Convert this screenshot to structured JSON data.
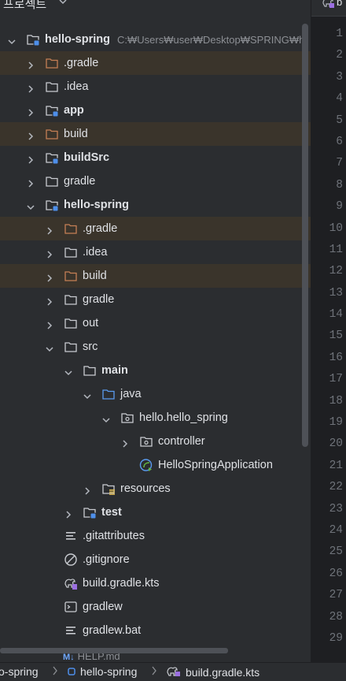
{
  "panel": {
    "title": "프로젝트"
  },
  "tree": {
    "root_label": "hello-spring",
    "root_path": "C:₩Users₩user₩Desktop₩SPRING₩h",
    "items": [
      {
        "label": "hello-spring",
        "depth": 0,
        "arrow": "down",
        "icon": "module-folder",
        "bold": true,
        "excluded": false
      },
      {
        "label": ".gradle",
        "depth": 1,
        "arrow": "right",
        "icon": "excluded-folder",
        "bold": false,
        "excluded": true
      },
      {
        "label": ".idea",
        "depth": 1,
        "arrow": "right",
        "icon": "folder",
        "bold": false,
        "excluded": false
      },
      {
        "label": "app",
        "depth": 1,
        "arrow": "right",
        "icon": "module-folder",
        "bold": true,
        "excluded": false
      },
      {
        "label": "build",
        "depth": 1,
        "arrow": "right",
        "icon": "excluded-folder",
        "bold": false,
        "excluded": true
      },
      {
        "label": "buildSrc",
        "depth": 1,
        "arrow": "right",
        "icon": "module-folder",
        "bold": true,
        "excluded": false
      },
      {
        "label": "gradle",
        "depth": 1,
        "arrow": "right",
        "icon": "folder",
        "bold": false,
        "excluded": false
      },
      {
        "label": "hello-spring",
        "depth": 1,
        "arrow": "down",
        "icon": "module-folder",
        "bold": true,
        "excluded": false
      },
      {
        "label": ".gradle",
        "depth": 2,
        "arrow": "right",
        "icon": "excluded-folder",
        "bold": false,
        "excluded": true
      },
      {
        "label": ".idea",
        "depth": 2,
        "arrow": "right",
        "icon": "folder",
        "bold": false,
        "excluded": false
      },
      {
        "label": "build",
        "depth": 2,
        "arrow": "right",
        "icon": "excluded-folder",
        "bold": false,
        "excluded": true
      },
      {
        "label": "gradle",
        "depth": 2,
        "arrow": "right",
        "icon": "folder",
        "bold": false,
        "excluded": false
      },
      {
        "label": "out",
        "depth": 2,
        "arrow": "right",
        "icon": "folder",
        "bold": false,
        "excluded": false
      },
      {
        "label": "src",
        "depth": 2,
        "arrow": "down",
        "icon": "folder",
        "bold": false,
        "excluded": false
      },
      {
        "label": "main",
        "depth": 3,
        "arrow": "down",
        "icon": "folder",
        "bold": true,
        "excluded": false
      },
      {
        "label": "java",
        "depth": 4,
        "arrow": "down",
        "icon": "source-folder",
        "bold": false,
        "excluded": false
      },
      {
        "label": "hello.hello_spring",
        "depth": 5,
        "arrow": "down",
        "icon": "package",
        "bold": false,
        "excluded": false
      },
      {
        "label": "controller",
        "depth": 6,
        "arrow": "right",
        "icon": "package",
        "bold": false,
        "excluded": false
      },
      {
        "label": "HelloSpringApplication",
        "depth": 6,
        "arrow": "none",
        "icon": "spring-class",
        "bold": false,
        "excluded": false
      },
      {
        "label": "resources",
        "depth": 4,
        "arrow": "right",
        "icon": "resources-folder",
        "bold": false,
        "excluded": false
      },
      {
        "label": "test",
        "depth": 3,
        "arrow": "right",
        "icon": "module-folder",
        "bold": true,
        "excluded": false
      },
      {
        "label": ".gitattributes",
        "depth": 2,
        "arrow": "none",
        "icon": "text-file",
        "bold": false,
        "excluded": false
      },
      {
        "label": ".gitignore",
        "depth": 2,
        "arrow": "none",
        "icon": "ignore-file",
        "bold": false,
        "excluded": false
      },
      {
        "label": "build.gradle.kts",
        "depth": 2,
        "arrow": "none",
        "icon": "gradle-file",
        "bold": false,
        "excluded": false
      },
      {
        "label": "gradlew",
        "depth": 2,
        "arrow": "none",
        "icon": "terminal-file",
        "bold": false,
        "excluded": false
      },
      {
        "label": "gradlew.bat",
        "depth": 2,
        "arrow": "none",
        "icon": "text-file",
        "bold": false,
        "excluded": false
      }
    ],
    "partial_item": {
      "badge": "M↓",
      "label": "HELP.md"
    }
  },
  "editor": {
    "tab_label": "b",
    "line_numbers": [
      "1",
      "2",
      "3",
      "4",
      "5",
      "6",
      "7",
      "8",
      "9",
      "10",
      "11",
      "12",
      "13",
      "14",
      "15",
      "16",
      "17",
      "18",
      "19",
      "20",
      "21",
      "22",
      "23",
      "24",
      "25",
      "26",
      "27",
      "28",
      "29"
    ]
  },
  "statusbar": {
    "crumbs": [
      "o-spring",
      "hello-spring",
      "build.gradle.kts"
    ]
  },
  "colors": {
    "panel_bg": "#2b2d30",
    "editor_bg": "#1e1f22",
    "excluded_row_bg": "#3a342b",
    "excluded_folder": "#c57f55",
    "module_dot": "#4e8fea",
    "text": "#dfe1e5",
    "muted": "#8c8f94"
  }
}
